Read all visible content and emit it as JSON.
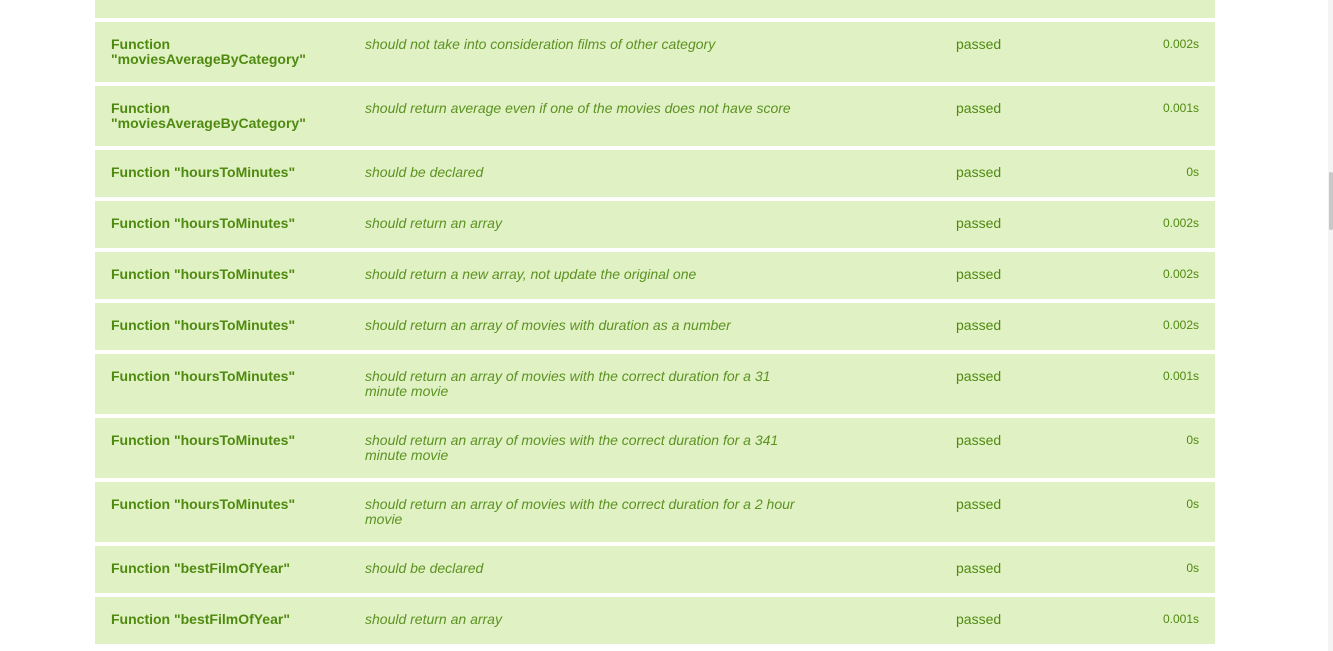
{
  "rows": [
    {
      "suite": "Function \"moviesAverageByCategory\"",
      "test": "should not take into consideration films of other category",
      "status": "passed",
      "duration": "0.002s"
    },
    {
      "suite": "Function \"moviesAverageByCategory\"",
      "test": "should return average even if one of the movies does not have score",
      "status": "passed",
      "duration": "0.001s"
    },
    {
      "suite": "Function \"hoursToMinutes\"",
      "test": "should be declared",
      "status": "passed",
      "duration": "0s"
    },
    {
      "suite": "Function \"hoursToMinutes\"",
      "test": "should return an array",
      "status": "passed",
      "duration": "0.002s"
    },
    {
      "suite": "Function \"hoursToMinutes\"",
      "test": "should return a new array, not update the original one",
      "status": "passed",
      "duration": "0.002s"
    },
    {
      "suite": "Function \"hoursToMinutes\"",
      "test": "should return an array of movies with duration as a number",
      "status": "passed",
      "duration": "0.002s"
    },
    {
      "suite": "Function \"hoursToMinutes\"",
      "test": "should return an array of movies with the correct duration for a 31 minute movie",
      "status": "passed",
      "duration": "0.001s"
    },
    {
      "suite": "Function \"hoursToMinutes\"",
      "test": "should return an array of movies with the correct duration for a 341 minute movie",
      "status": "passed",
      "duration": "0s"
    },
    {
      "suite": "Function \"hoursToMinutes\"",
      "test": "should return an array of movies with the correct duration for a 2 hour movie",
      "status": "passed",
      "duration": "0s"
    },
    {
      "suite": "Function \"bestFilmOfYear\"",
      "test": "should be declared",
      "status": "passed",
      "duration": "0s"
    },
    {
      "suite": "Function \"bestFilmOfYear\"",
      "test": "should return an array",
      "status": "passed",
      "duration": "0.001s"
    }
  ]
}
